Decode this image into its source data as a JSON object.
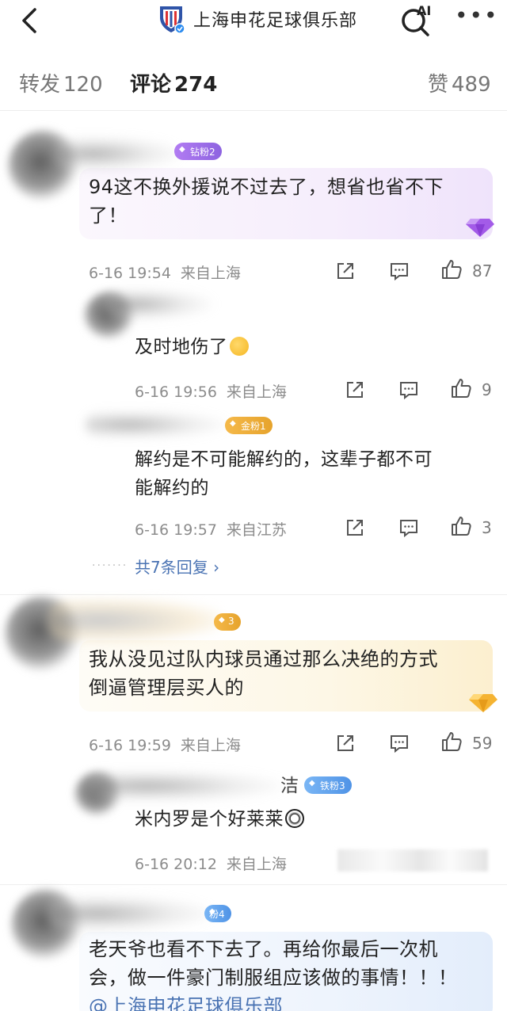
{
  "header": {
    "title": "上海申花足球俱乐部",
    "ai_label": "AI"
  },
  "tabs": {
    "repost_label": "转发",
    "repost_count": "120",
    "comment_label": "评论",
    "comment_count": "274",
    "like_label": "赞",
    "like_count": "489"
  },
  "comments": [
    {
      "badge": "钻粉2",
      "text_line1": "94这不换外援说不过去了，想省也省不下",
      "text_line2": "了！",
      "time": "6-16 19:54",
      "location": "来自上海",
      "likes": "87",
      "replies": [
        {
          "text": "及时地伤了",
          "time": "6-16 19:56",
          "location": "来自上海",
          "likes": "9"
        },
        {
          "badge": "金粉1",
          "text_line1": "解约是不可能解约的，这辈子都不可",
          "text_line2": "能解约的",
          "time": "6-16 19:57",
          "location": "来自江苏",
          "likes": "3"
        }
      ],
      "more_replies": "共7条回复 ›"
    },
    {
      "badge": "3",
      "text_line1": "我从没见过队内球员通过那么决绝的方式",
      "text_line2": "倒逼管理层买人的",
      "time": "6-16 19:59",
      "location": "来自上海",
      "likes": "59",
      "replies": [
        {
          "name_tail": "洁",
          "badge": "铁粉3",
          "text": "米内罗是个好莱莱",
          "time": "6-16 20:12",
          "location": "来自上海"
        }
      ]
    },
    {
      "badge": "粉4",
      "text_line1": "老天爷也看不下去了。再给你最后一次机",
      "text_line2": "会，做一件豪门制服组应该做的事情！！！",
      "text_line3": "@上海申花足球俱乐部"
    }
  ],
  "colors": {
    "link": "#4a73b3",
    "meta": "#8c8c8c",
    "badge_purple": "#a070ea",
    "badge_gold": "#eeae38",
    "badge_blue": "#5f9fec"
  }
}
